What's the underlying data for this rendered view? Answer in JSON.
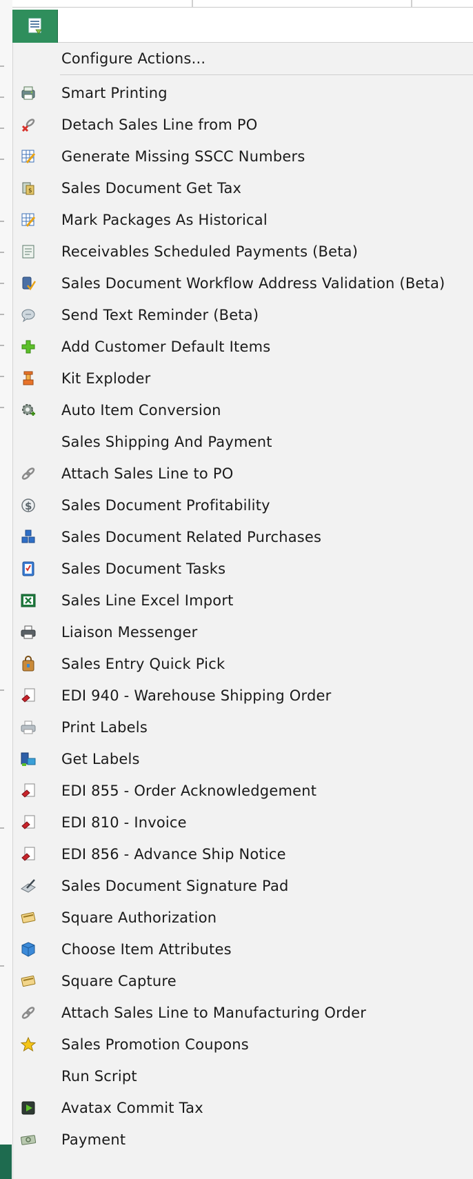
{
  "menu": {
    "items": [
      {
        "label": "Configure Actions...",
        "icon": "configure-icon"
      },
      {
        "label": "Smart Printing",
        "icon": "smart-printing-icon"
      },
      {
        "label": "Detach Sales Line from PO",
        "icon": "detach-icon"
      },
      {
        "label": "Generate Missing SSCC Numbers",
        "icon": "grid-edit-icon"
      },
      {
        "label": "Sales Document Get Tax",
        "icon": "tax-icon"
      },
      {
        "label": "Mark Packages As Historical",
        "icon": "grid-edit-icon"
      },
      {
        "label": "Receivables Scheduled Payments (Beta)",
        "icon": "document-icon"
      },
      {
        "label": "Sales Document Workflow Address Validation (Beta)",
        "icon": "address-validation-icon"
      },
      {
        "label": "Send Text Reminder (Beta)",
        "icon": "speech-bubble-icon"
      },
      {
        "label": "Add Customer Default Items",
        "icon": "plus-icon"
      },
      {
        "label": "Kit Exploder",
        "icon": "kit-exploder-icon"
      },
      {
        "label": "Auto Item Conversion",
        "icon": "gear-icon"
      },
      {
        "label": "Sales Shipping And Payment",
        "icon": null
      },
      {
        "label": "Attach Sales Line to PO",
        "icon": "link-icon"
      },
      {
        "label": "Sales Document Profitability",
        "icon": "dollar-icon"
      },
      {
        "label": "Sales Document Related Purchases",
        "icon": "cubes-icon"
      },
      {
        "label": "Sales Document Tasks",
        "icon": "checklist-icon"
      },
      {
        "label": "Sales Line Excel Import",
        "icon": "excel-icon"
      },
      {
        "label": "Liaison Messenger",
        "icon": "printer-icon"
      },
      {
        "label": "Sales Entry Quick Pick",
        "icon": "bag-icon"
      },
      {
        "label": "EDI 940 - Warehouse Shipping Order",
        "icon": "edi-icon"
      },
      {
        "label": "Print Labels",
        "icon": "printer-light-icon"
      },
      {
        "label": "Get Labels",
        "icon": "computer-icon"
      },
      {
        "label": "EDI 855 - Order Acknowledgement",
        "icon": "edi-icon"
      },
      {
        "label": "EDI 810 - Invoice",
        "icon": "edi-icon"
      },
      {
        "label": "EDI 856 - Advance Ship Notice",
        "icon": "edi-icon"
      },
      {
        "label": "Sales Document Signature Pad",
        "icon": "signature-pad-icon"
      },
      {
        "label": "Square Authorization",
        "icon": "card-icon"
      },
      {
        "label": "Choose Item Attributes",
        "icon": "cube-icon"
      },
      {
        "label": "Square Capture",
        "icon": "card-icon"
      },
      {
        "label": "Attach Sales Line to Manufacturing Order",
        "icon": "link-icon"
      },
      {
        "label": "Sales Promotion Coupons",
        "icon": "star-icon"
      },
      {
        "label": "Run Script",
        "icon": null
      },
      {
        "label": "Avatax Commit Tax",
        "icon": "avatax-icon"
      },
      {
        "label": "Payment",
        "icon": "money-icon"
      }
    ]
  },
  "colors": {
    "accent_green": "#2f8e5c",
    "menu_background": "#f2f2f2",
    "text": "#1a1a1a"
  }
}
